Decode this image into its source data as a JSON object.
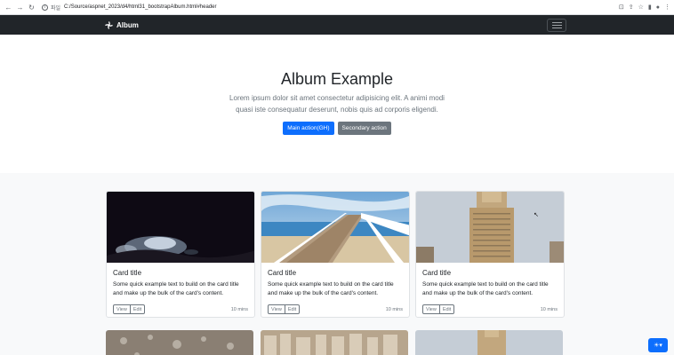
{
  "browser": {
    "page_label": "파일",
    "url": "C:/Source/aspnet_2023/d4/html31_bootstrapAlbum.html#header"
  },
  "navbar": {
    "brand": "Album"
  },
  "hero": {
    "title": "Album Example",
    "lead": "Lorem ipsum dolor sit amet consectetur adipisicing elit. A animi modi quasi iste consequatur deserunt, nobis quis ad corporis eligendi.",
    "primary_button": "Main action(GH)",
    "secondary_button": "Secondary action"
  },
  "cards": [
    {
      "title": "Card title",
      "text": "Some quick example text to build on the card title and make up the bulk of the card's content.",
      "view": "View",
      "edit": "Edit",
      "time": "10 mins",
      "image": "dark night landscape"
    },
    {
      "title": "Card title",
      "text": "Some quick example text to build on the card title and make up the bulk of the card's content.",
      "view": "View",
      "edit": "Edit",
      "time": "10 mins",
      "image": "pier over ocean"
    },
    {
      "title": "Card title",
      "text": "Some quick example text to build on the card title and make up the bulk of the card's content.",
      "view": "View",
      "edit": "Edit",
      "time": "10 mins",
      "image": "skyscraper"
    }
  ],
  "colors": {
    "primary": "#0d6efd",
    "secondary": "#6c757d",
    "navbar": "#212529"
  },
  "theme_toggle": {
    "icon": "sun-icon"
  }
}
